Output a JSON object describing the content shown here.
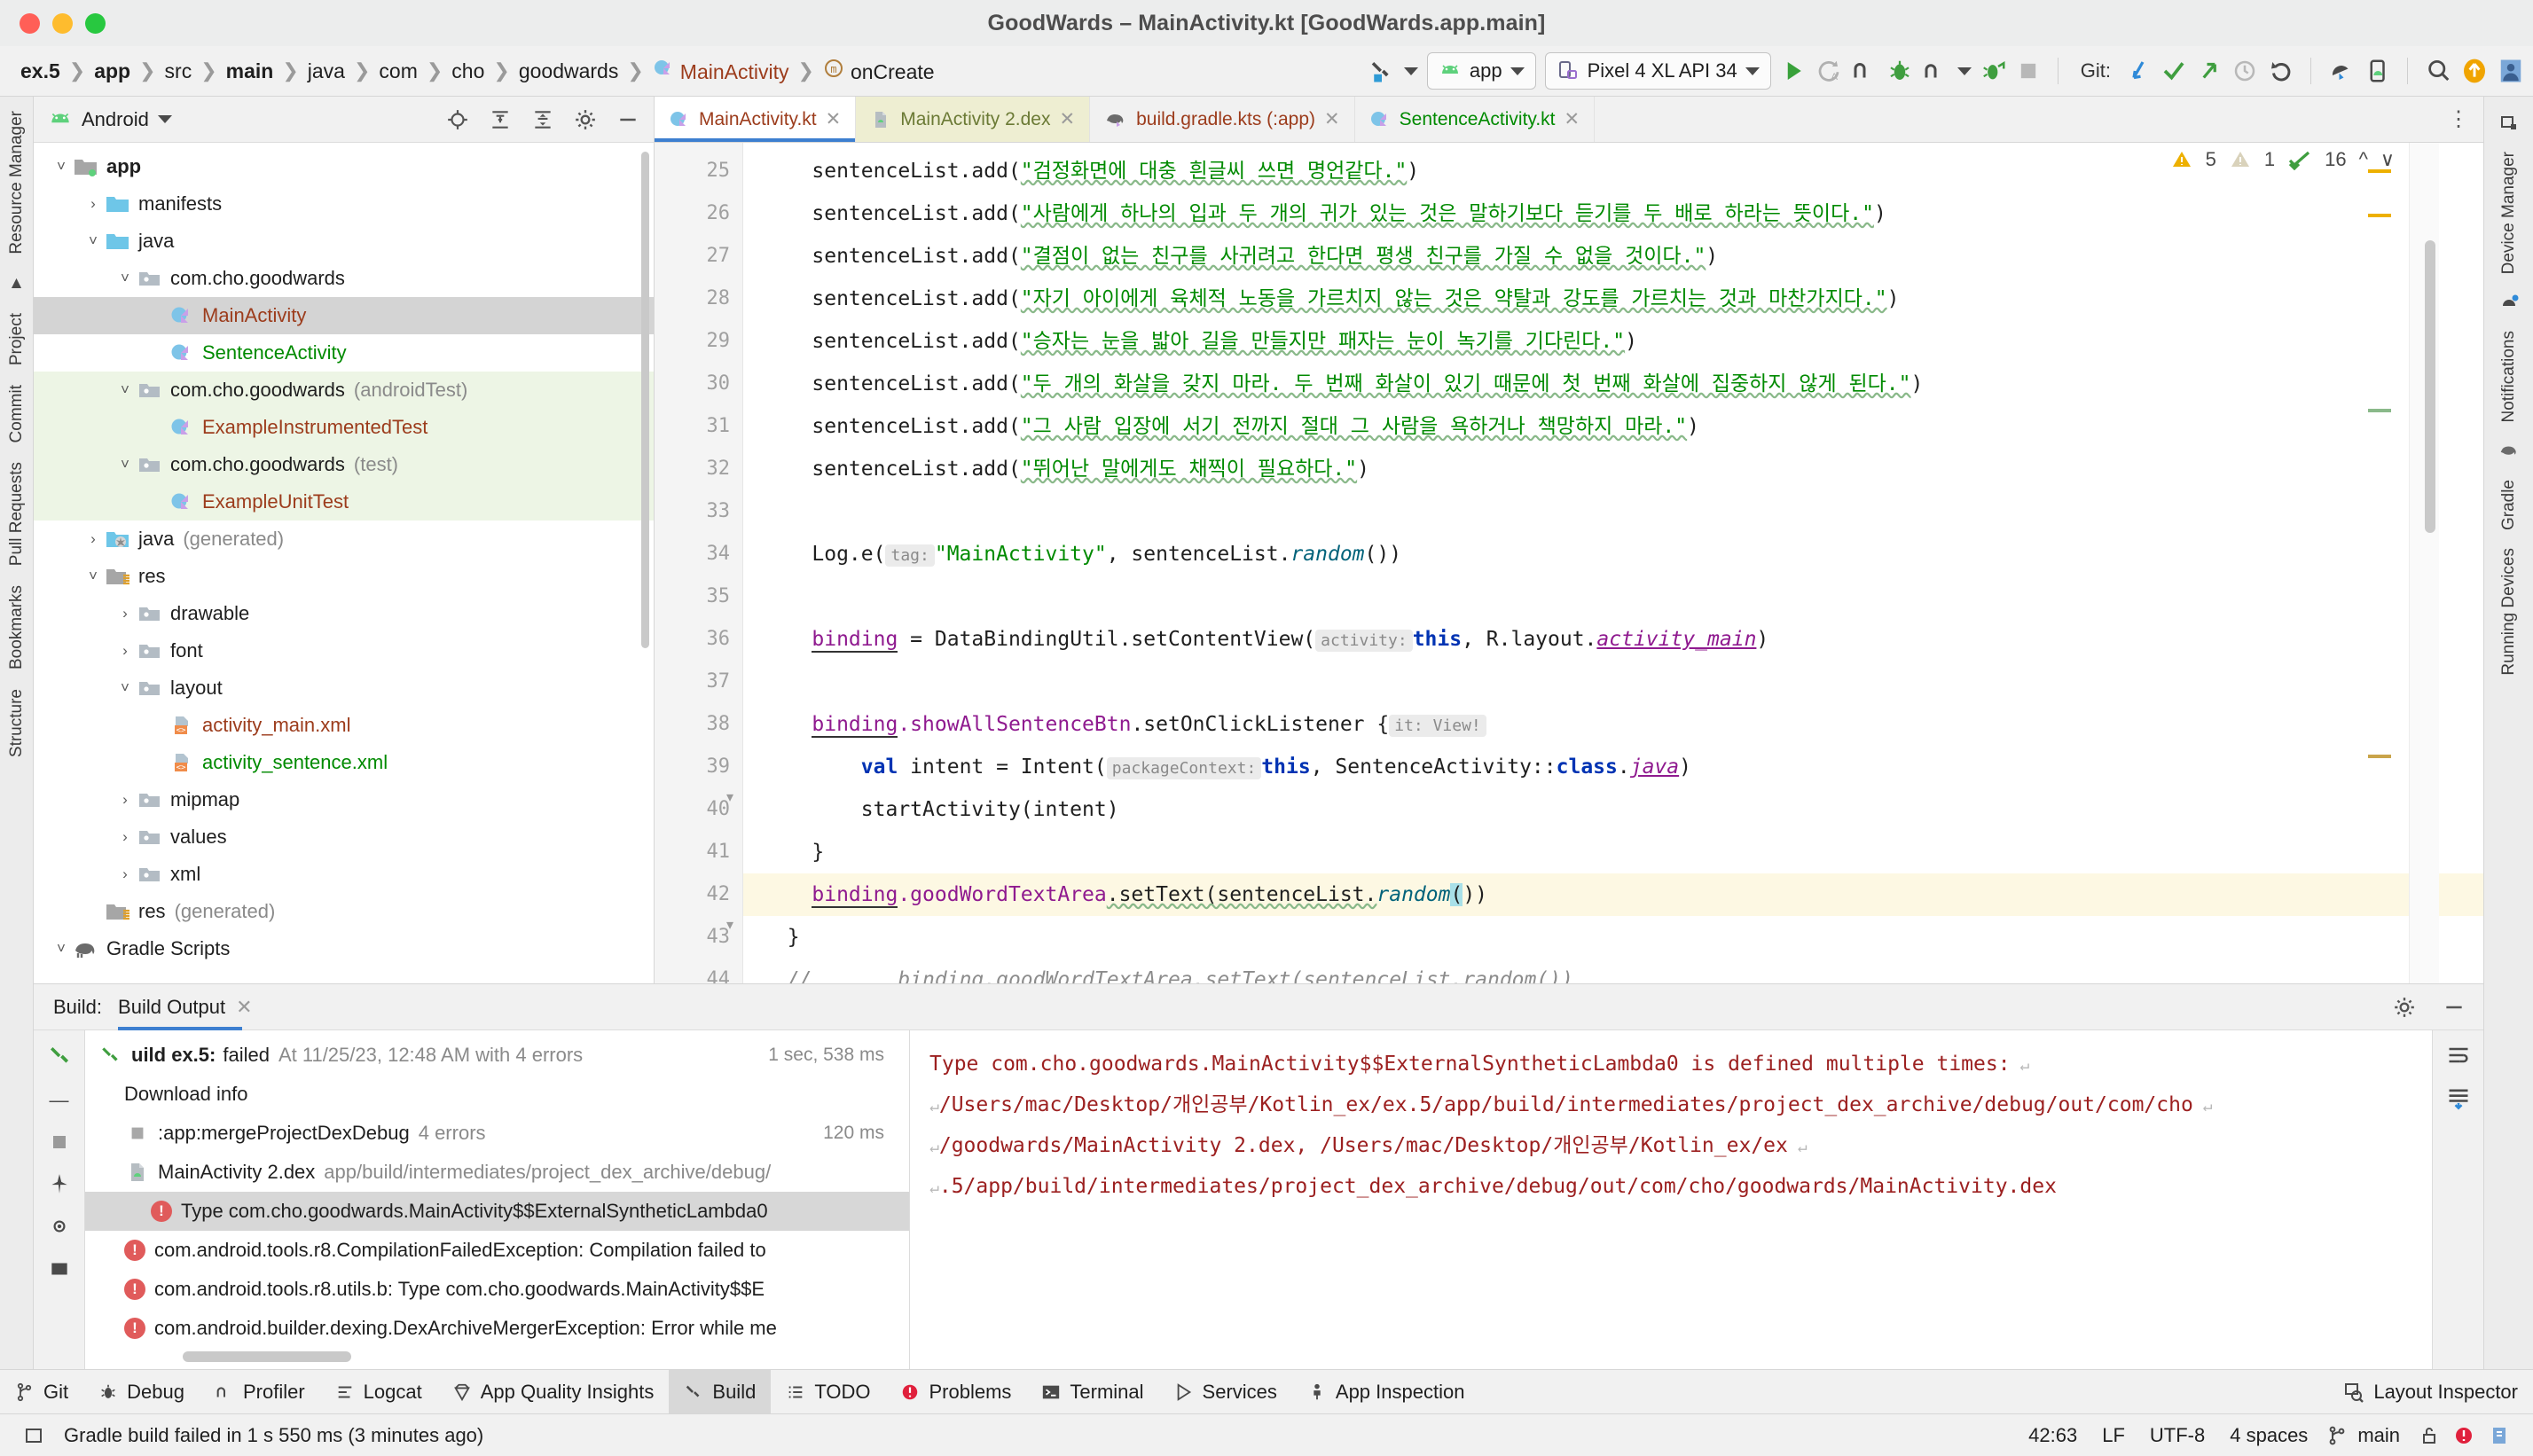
{
  "window": {
    "title": "GoodWards – MainActivity.kt [GoodWards.app.main]"
  },
  "breadcrumbs": [
    {
      "label": "ex.5",
      "bold": true
    },
    {
      "label": "app",
      "bold": true
    },
    {
      "label": "src",
      "bold": false
    },
    {
      "label": "main",
      "bold": true
    },
    {
      "label": "java",
      "bold": false
    },
    {
      "label": "com",
      "bold": false
    },
    {
      "label": "cho",
      "bold": false
    },
    {
      "label": "goodwards",
      "bold": false
    },
    {
      "label": "MainActivity",
      "bold": false,
      "kind": "kotlin-class"
    },
    {
      "label": "onCreate",
      "bold": false,
      "kind": "method"
    }
  ],
  "toolbar": {
    "build_variant_icon": "hammer-icon",
    "run_config": "app",
    "device": "Pixel 4 XL API 34",
    "git_label": "Git:",
    "icons": [
      "run-icon",
      "rerun-icon",
      "more-run-icon",
      "debug-icon",
      "attach-debugger-icon",
      "profiler-icon",
      "apply-changes-icon",
      "stop-icon",
      "git-update-icon",
      "git-commit-icon",
      "git-push-icon",
      "git-history-icon",
      "git-rollback-icon",
      "device-explorer-icon",
      "device-manager-icon",
      "search-icon",
      "ai-assistant-icon",
      "profile-icon"
    ]
  },
  "left_rail": [
    "Resource Manager",
    "Project",
    "Commit",
    "Pull Requests",
    "Bookmarks",
    "Structure"
  ],
  "right_rail": [
    "Device Manager",
    "Notifications",
    "Gradle",
    "Running Devices"
  ],
  "project_panel": {
    "title": "Android",
    "header_icons": [
      "locate-icon",
      "expand-all-icon",
      "collapse-all-icon",
      "settings-icon",
      "hide-icon"
    ],
    "tree": [
      {
        "label": "app",
        "depth": 0,
        "arrow": "down",
        "icon": "module-folder-icon",
        "bold": true
      },
      {
        "label": "manifests",
        "depth": 1,
        "arrow": "right",
        "icon": "folder-blue-icon"
      },
      {
        "label": "java",
        "depth": 1,
        "arrow": "down",
        "icon": "folder-blue-icon"
      },
      {
        "label": "com.cho.goodwards",
        "depth": 2,
        "arrow": "down",
        "icon": "package-icon"
      },
      {
        "label": "MainActivity",
        "depth": 3,
        "arrow": "none",
        "icon": "kotlin-class-icon",
        "color": "kt-brown",
        "selected": true
      },
      {
        "label": "SentenceActivity",
        "depth": 3,
        "arrow": "none",
        "icon": "kotlin-class-icon",
        "color": "kt-green"
      },
      {
        "label": "com.cho.goodwards",
        "suffix": "(androidTest)",
        "depth": 2,
        "arrow": "down",
        "icon": "package-icon",
        "testbg": true
      },
      {
        "label": "ExampleInstrumentedTest",
        "depth": 3,
        "arrow": "none",
        "icon": "kotlin-class-icon",
        "color": "kt-brown",
        "testbg": true
      },
      {
        "label": "com.cho.goodwards",
        "suffix": "(test)",
        "depth": 2,
        "arrow": "down",
        "icon": "package-icon",
        "testbg": true
      },
      {
        "label": "ExampleUnitTest",
        "depth": 3,
        "arrow": "none",
        "icon": "kotlin-class-icon",
        "color": "kt-brown",
        "testbg": true
      },
      {
        "label": "java",
        "suffix": "(generated)",
        "depth": 1,
        "arrow": "right",
        "icon": "folder-generated-icon"
      },
      {
        "label": "res",
        "depth": 1,
        "arrow": "down",
        "icon": "res-folder-icon"
      },
      {
        "label": "drawable",
        "depth": 2,
        "arrow": "right",
        "icon": "package-icon"
      },
      {
        "label": "font",
        "depth": 2,
        "arrow": "right",
        "icon": "package-icon"
      },
      {
        "label": "layout",
        "depth": 2,
        "arrow": "down",
        "icon": "package-icon"
      },
      {
        "label": "activity_main.xml",
        "depth": 3,
        "arrow": "none",
        "icon": "layout-xml-icon",
        "color": "kt-brown"
      },
      {
        "label": "activity_sentence.xml",
        "depth": 3,
        "arrow": "none",
        "icon": "layout-xml-icon",
        "color": "kt-green"
      },
      {
        "label": "mipmap",
        "depth": 2,
        "arrow": "right",
        "icon": "package-icon"
      },
      {
        "label": "values",
        "depth": 2,
        "arrow": "right",
        "icon": "package-icon"
      },
      {
        "label": "xml",
        "depth": 2,
        "arrow": "right",
        "icon": "package-icon"
      },
      {
        "label": "res",
        "suffix": "(generated)",
        "depth": 1,
        "arrow": "none",
        "icon": "res-folder-icon"
      },
      {
        "label": "Gradle Scripts",
        "depth": 0,
        "arrow": "down",
        "icon": "gradle-elephant-icon"
      }
    ]
  },
  "editor": {
    "tabs": [
      {
        "label": "MainActivity.kt",
        "icon": "kotlin-class-icon",
        "color": "t-brown",
        "active": true
      },
      {
        "label": "MainActivity 2.dex",
        "icon": "dex-file-icon",
        "color": "t-olive",
        "dex": true
      },
      {
        "label": "build.gradle.kts (:app)",
        "icon": "gradle-elephant-icon",
        "color": "t-brown"
      },
      {
        "label": "SentenceActivity.kt",
        "icon": "kotlin-class-icon",
        "color": "t-green"
      }
    ],
    "inspections": {
      "warnings": "5",
      "weak_warnings": "1",
      "checks": "16"
    },
    "first_line": 25,
    "lines": [
      {
        "n": 25,
        "html": "    <s>sentenceList</s>.<s>add</s>(<q>\"검정화면에 대충 흰글씨 쓰면 명언같다.\"</q>)"
      },
      {
        "n": 26,
        "html": "line26"
      },
      {
        "n": 27,
        "html": "line27"
      },
      {
        "n": 28,
        "html": "line28"
      },
      {
        "n": 29,
        "html": "line29"
      },
      {
        "n": 30,
        "html": "line30"
      },
      {
        "n": 31,
        "html": "line31"
      },
      {
        "n": 32,
        "html": "line32"
      },
      {
        "n": 33,
        "html": ""
      },
      {
        "n": 34,
        "html": "log"
      },
      {
        "n": 35,
        "html": ""
      },
      {
        "n": 36,
        "html": "binding"
      },
      {
        "n": 37,
        "html": ""
      },
      {
        "n": 38,
        "html": "listener"
      },
      {
        "n": 39,
        "html": "intent"
      },
      {
        "n": 40,
        "html": "start"
      },
      {
        "n": 41,
        "html": "}"
      },
      {
        "n": 42,
        "html": "settext",
        "highlight": true
      },
      {
        "n": 43,
        "html": "}"
      },
      {
        "n": 44,
        "html": "comment"
      }
    ],
    "code_text": {
      "l25": "sentenceList.add(\"검정화면에 대충 흰글씨 쓰면 명언같다.\")",
      "l26": "sentenceList.add(\"사람에게 하나의 입과 두 개의 귀가 있는 것은 말하기보다 듣기를 두 배로 하라는 뜻이다.\")",
      "l27": "sentenceList.add(\"결점이 없는 친구를 사귀려고 한다면 평생 친구를 가질 수 없을 것이다.\")",
      "l28": "sentenceList.add(\"자기 아이에게 육체적 노동을 가르치지 않는 것은 약탈과 강도를 가르치는 것과 마찬가지다.\")",
      "l29": "sentenceList.add(\"승자는 눈을 밟아 길을 만들지만 패자는 눈이 녹기를 기다린다.\")",
      "l30": "sentenceList.add(\"두 개의 화살을 갖지 마라. 두 번째 화살이 있기 때문에 첫 번째 화살에 집중하지 않게 된다.\")",
      "l31": "sentenceList.add(\"그 사람 입장에 서기 전까지 절대 그 사람을 욕하거나 책망하지 마라.\")",
      "l32": "sentenceList.add(\"뛰어난 말에게도 채찍이 필요하다.\")",
      "l34_call": "Log.e(",
      "l34_hint": "tag:",
      "l34_str": "\"MainActivity\"",
      "l34_rest": ", sentenceList.",
      "l34_random": "random",
      "l34_tail": "())",
      "l36_binding": "binding",
      "l36_mid": " = DataBindingUtil.setContentView(",
      "l36_hint": "activity:",
      "l36_this": "this",
      "l36_comma": ", R.layout.",
      "l36_layout": "activity_main",
      "l36_tail": ")",
      "l38_binding": "binding",
      "l38_prop": ".showAllSentenceBtn",
      "l38_mid": ".setOnClickListener {",
      "l38_hint": "it: View!",
      "l39_val": "val",
      "l39_mid": " intent = Intent(",
      "l39_hint": "packageContext:",
      "l39_this": "this",
      "l39_comma": ", SentenceActivity::",
      "l39_class": "class",
      "l39_dot": ".",
      "l39_java": "java",
      "l39_tail": ")",
      "l40": "startActivity(intent)",
      "l41": "}",
      "l42_binding": "binding",
      "l42_prop": ".goodWordTextArea",
      "l42_mid": ".setText(sentenceList.",
      "l42_random": "random",
      "l42_caret": "(",
      "l42_tail": "))",
      "l43": "}",
      "l44": "//       binding.goodWordTextArea.setText(sentenceList.random())"
    }
  },
  "build_panel": {
    "label": "Build:",
    "tab": "Build Output",
    "rail_icons": [
      "restart-icon",
      "filter-icon",
      "stop-icon",
      "pin-icon",
      "eye-icon",
      "settings-icon"
    ],
    "tree": [
      {
        "text": "uild ex.5:",
        "strong": true,
        "status": "failed",
        "detail": "At 11/25/23, 12:48 AM with 4 errors",
        "time": "1 sec, 538 ms",
        "icon": "build-icon"
      },
      {
        "text": "Download info",
        "indent": 1
      },
      {
        "text": ":app:mergeProjectDexDebug",
        "detail": "4 errors",
        "time": "120 ms",
        "indent": 1,
        "icon": "task-icon"
      },
      {
        "text": "MainActivity 2.dex",
        "detail": "app/build/intermediates/project_dex_archive/debug/",
        "indent": 1,
        "icon": "dex-file-icon"
      },
      {
        "text": "Type com.cho.goodwards.MainActivity$$ExternalSyntheticLambda0",
        "indent": 2,
        "error": true,
        "selected": true
      },
      {
        "text": "com.android.tools.r8.CompilationFailedException: Compilation failed to",
        "indent": 1,
        "error": true
      },
      {
        "text": "com.android.tools.r8.utils.b: Type com.cho.goodwards.MainActivity$$E",
        "indent": 1,
        "error": true
      },
      {
        "text": "com.android.builder.dexing.DexArchiveMergerException: Error while me",
        "indent": 1,
        "error": true
      }
    ],
    "detail_lines": [
      "Type com.cho.goodwards.MainActivity$$ExternalSyntheticLambda0 is defined multiple times:",
      "/Users/mac/Desktop/개인공부/Kotlin_ex/ex.5/app/build/intermediates/project_dex_archive/debug/out/com/cho",
      "/goodwards/MainActivity 2.dex, /Users/mac/Desktop/개인공부/Kotlin_ex/ex",
      ".5/app/build/intermediates/project_dex_archive/debug/out/com/cho/goodwards/MainActivity.dex"
    ],
    "detail_rail_icons": [
      "wrap-icon",
      "scroll-end-icon"
    ]
  },
  "tool_windows": [
    {
      "label": "Git",
      "icon": "git-branch-icon"
    },
    {
      "label": "Debug",
      "icon": "debug-bug-icon"
    },
    {
      "label": "Profiler",
      "icon": "profiler-icon"
    },
    {
      "label": "Logcat",
      "icon": "logcat-icon"
    },
    {
      "label": "App Quality Insights",
      "icon": "diamond-icon"
    },
    {
      "label": "Build",
      "icon": "hammer-icon",
      "active": true
    },
    {
      "label": "TODO",
      "icon": "list-icon"
    },
    {
      "label": "Problems",
      "icon": "error-circle-icon"
    },
    {
      "label": "Terminal",
      "icon": "terminal-icon"
    },
    {
      "label": "Services",
      "icon": "services-icon"
    },
    {
      "label": "App Inspection",
      "icon": "inspection-icon"
    }
  ],
  "tool_windows_right": [
    {
      "label": "Layout Inspector",
      "icon": "layout-inspector-icon"
    }
  ],
  "status_bar": {
    "message": "Gradle build failed in 1 s 550 ms (3 minutes ago)",
    "caret": "42:63",
    "line_sep": "LF",
    "encoding": "UTF-8",
    "indent": "4 spaces",
    "branch": "main",
    "icons": [
      "memory-icon",
      "lock-icon",
      "error-circle-icon",
      "inspection-icon"
    ]
  },
  "colors": {
    "accent_blue": "#3d7fd0",
    "error_red": "#e05b5b",
    "string_green": "#008a00",
    "keyword_blue": "#0033b3",
    "identifier_purple": "#8f1a8f",
    "kotlin_brown": "#9c3c1c",
    "warning_yellow": "#edb000"
  }
}
